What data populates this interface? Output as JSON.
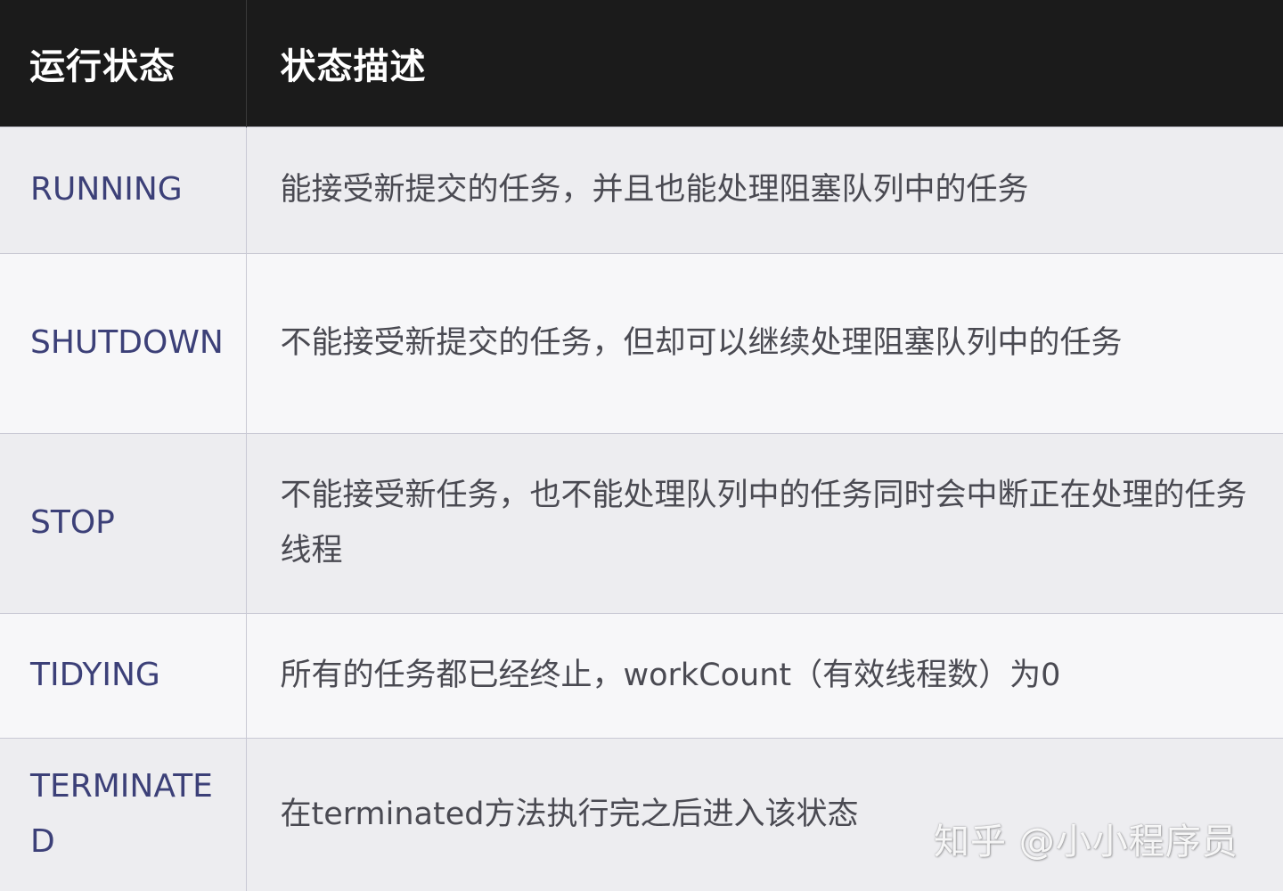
{
  "table": {
    "headers": {
      "state": "运行状态",
      "description": "状态描述"
    },
    "rows": [
      {
        "state": "RUNNING",
        "description": "能接受新提交的任务，并且也能处理阻塞队列中的任务"
      },
      {
        "state": "SHUTDOWN",
        "description": "不能接受新提交的任务，但却可以继续处理阻塞队列中的任务"
      },
      {
        "state": "STOP",
        "description": "不能接受新任务，也不能处理队列中的任务同时会中断正在处理的任务线程"
      },
      {
        "state": "TIDYING",
        "description": "所有的任务都已经终止，workCount（有效线程数）为0"
      },
      {
        "state": "TERMINATED",
        "description": "在terminated方法执行完之后进入该状态"
      }
    ]
  },
  "watermark": "知乎 @小小程序员"
}
